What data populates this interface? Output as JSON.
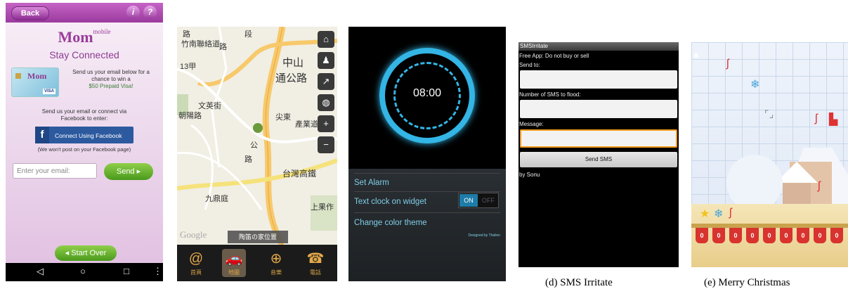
{
  "mobile_mom": {
    "back": "Back",
    "info_icon": "i",
    "help_icon": "?",
    "logo_small": "mobile",
    "logo": "Mom",
    "tagline": "Stay Connected",
    "card_logo": "Mom",
    "card_visa": "VISA",
    "offer_line1": "Send us your email below for a",
    "offer_line2": "chance to win a",
    "offer_prize": "$50 Prepaid Visa!",
    "enter_line1": "Send us your email or connect via",
    "enter_line2": "Facebook to enter:",
    "facebook_button": "Connect Using Facebook",
    "facebook_note": "(We won't post on your Facebook page)",
    "email_placeholder": "Enter your email:",
    "send_button": "Send",
    "start_over": "Start Over"
  },
  "map": {
    "location_label": "陶笛の家位置",
    "google": "Google",
    "labels": [
      "路",
      "竹南聯絡道",
      "段",
      "路",
      "中山",
      "通公路",
      "尖東",
      "產業道",
      "朝陽路",
      "文英街",
      "台灣高鐵",
      "九鼎庭",
      "公",
      "上果作",
      "路",
      "13甲"
    ],
    "dock": [
      {
        "glyph": "@",
        "label": "首頁"
      },
      {
        "glyph": "🚗",
        "label": "地圖"
      },
      {
        "glyph": "⊕",
        "label": "音樂"
      },
      {
        "glyph": "☎",
        "label": "電話"
      }
    ]
  },
  "clock": {
    "time": "08:00",
    "set_alarm": "Set Alarm",
    "text_clock": "Text clock on widget",
    "toggle_on": "ON",
    "toggle_off": "OFF",
    "change_color": "Change color theme",
    "designed_by": "Designed by Thalion"
  },
  "sms": {
    "app_title": "SMSIrritate",
    "free_app": "Free App: Do not buy or sell",
    "send_to": "Send to:",
    "number_label": "Number of SMS to flood:",
    "message_label": "Message:",
    "send_button": "Send SMS",
    "by": "by Sonu",
    "caption": "(d) SMS Irritate"
  },
  "christmas": {
    "caption": "(e) Merry Christmas"
  }
}
